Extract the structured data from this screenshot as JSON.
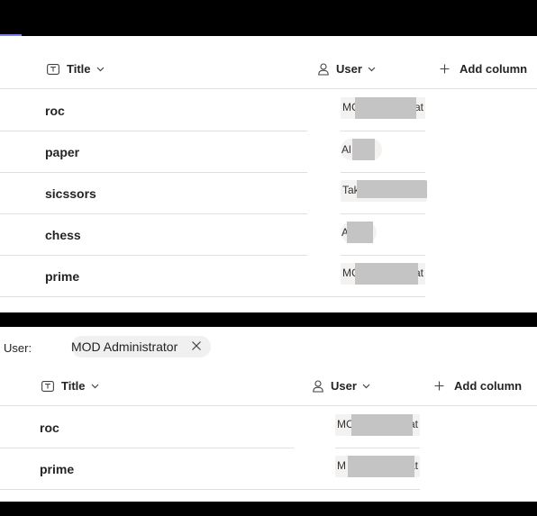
{
  "top_view": {
    "columns": {
      "title_label": "Title",
      "user_label": "User",
      "add_column_label": "Add column"
    },
    "rows": [
      {
        "title": "roc",
        "user_prefix": "MC",
        "user_suffix": "at"
      },
      {
        "title": "paper",
        "user_prefix": "Al",
        "user_suffix": ""
      },
      {
        "title": "sicssors",
        "user_prefix": "Tak",
        "user_suffix": ""
      },
      {
        "title": "chess",
        "user_prefix": "A",
        "user_suffix": ""
      },
      {
        "title": "prime",
        "user_prefix": "MC",
        "user_suffix": "at"
      }
    ]
  },
  "filtered_view": {
    "filter": {
      "label": "User:",
      "chip_value": "MOD Administrator"
    },
    "columns": {
      "title_label": "Title",
      "user_label": "User",
      "add_column_label": "Add column"
    },
    "rows": [
      {
        "title": "roc",
        "user_prefix": "MC",
        "user_suffix": "at"
      },
      {
        "title": "prime",
        "user_prefix": "M",
        "user_suffix": "at"
      }
    ]
  },
  "icons": {
    "title_column": "text-field-icon",
    "user_column": "person-icon",
    "add_column": "plus-icon",
    "sort": "chevron-down-icon",
    "remove_filter": "close-icon"
  },
  "colors": {
    "accent": "#7b83eb",
    "redaction": "#c4c4c4",
    "user_cell_bg": "#f3f2f1"
  }
}
